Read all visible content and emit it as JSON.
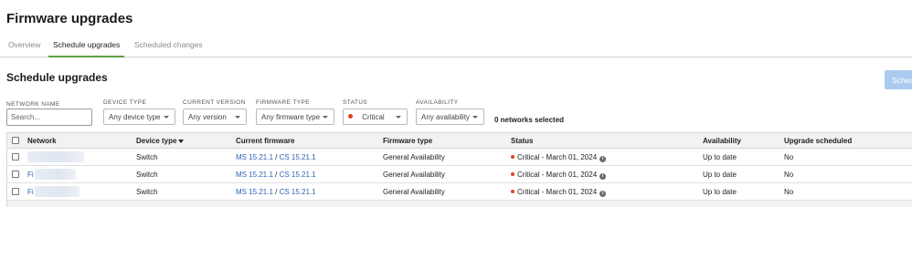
{
  "page": {
    "title": "Firmware upgrades"
  },
  "tabs": [
    {
      "label": "Overview",
      "active": false
    },
    {
      "label": "Schedule upgrades",
      "active": true
    },
    {
      "label": "Scheduled changes",
      "active": false
    }
  ],
  "section": {
    "title": "Schedule upgrades",
    "schedule_button_label": "Sched"
  },
  "filters": {
    "network_name": {
      "label": "NETWORK NAME",
      "placeholder": "Search...",
      "value": ""
    },
    "device_type": {
      "label": "DEVICE TYPE",
      "value": "Any device type"
    },
    "current_version": {
      "label": "CURRENT VERSION",
      "value": "Any version"
    },
    "firmware_type": {
      "label": "FIRMWARE TYPE",
      "value": "Any firmware type"
    },
    "status": {
      "label": "STATUS",
      "value": "Critical",
      "dot_color": "#e0411f"
    },
    "availability": {
      "label": "AVAILABILITY",
      "value": "Any availability"
    }
  },
  "selection": {
    "count_text": "0 networks selected"
  },
  "table": {
    "columns": [
      "Network",
      "Device type",
      "Current firmware",
      "Firmware type",
      "Status",
      "Availability",
      "Upgrade scheduled"
    ],
    "sort_column": "Device type",
    "rows": [
      {
        "network": "",
        "device_type": "Switch",
        "fw_ms": "MS 15.21.1",
        "fw_sep": " / ",
        "fw_cs": "CS 15.21.1",
        "firmware_type": "General Availability",
        "status": "Critical - March 01, 2024",
        "availability": "Up to date",
        "upgrade_scheduled": "No"
      },
      {
        "network": "Fi",
        "device_type": "Switch",
        "fw_ms": "MS 15.21.1",
        "fw_sep": " / ",
        "fw_cs": "CS 15.21.1",
        "firmware_type": "General Availability",
        "status": "Critical - March 01, 2024",
        "availability": "Up to date",
        "upgrade_scheduled": "No"
      },
      {
        "network": "Fi",
        "device_type": "Switch",
        "fw_ms": "MS 15.21.1",
        "fw_sep": " / ",
        "fw_cs": "CS 15.21.1",
        "firmware_type": "General Availability",
        "status": "Critical - March 01, 2024",
        "availability": "Up to date",
        "upgrade_scheduled": "No"
      }
    ]
  },
  "colors": {
    "accent_tab": "#62a04a",
    "link": "#2e63b5",
    "critical": "#e0411f",
    "button": "#aacbef"
  }
}
